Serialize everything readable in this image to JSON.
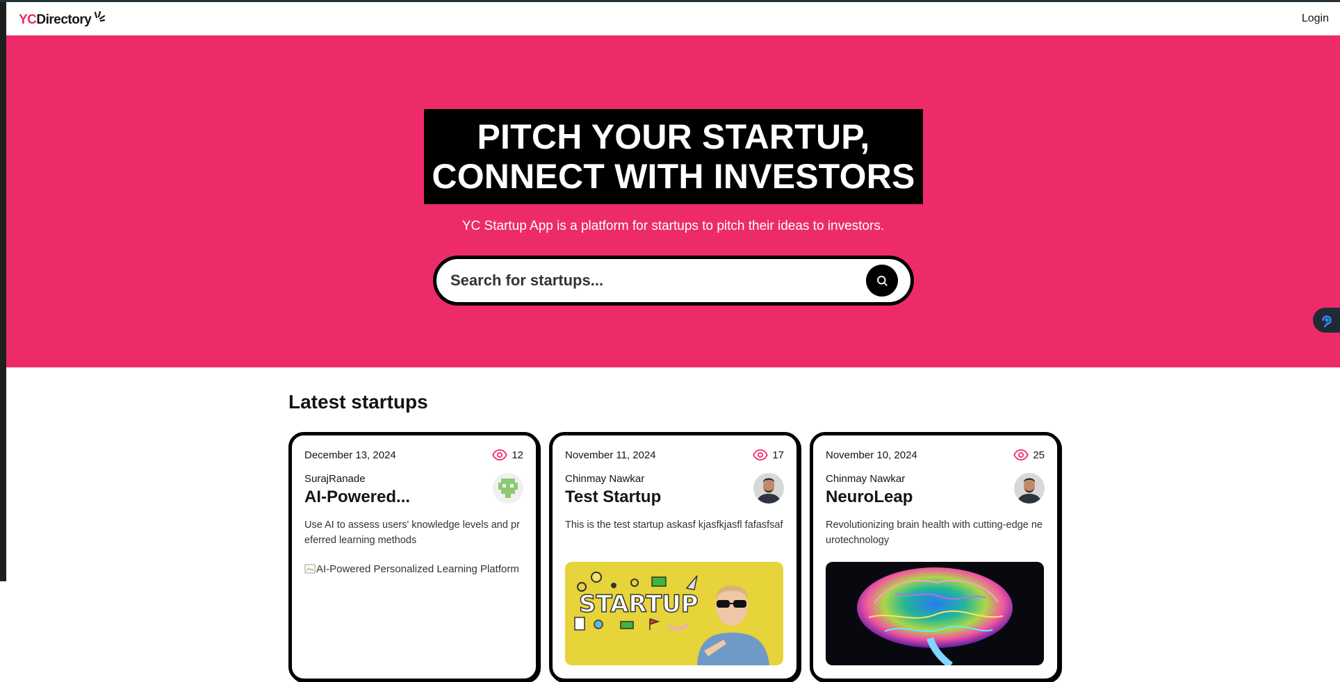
{
  "nav": {
    "logo_yc": "YC",
    "logo_directory": "Directory",
    "login_label": "Login"
  },
  "hero": {
    "title_line1": "Pitch Your Startup,",
    "title_line2": "Connect With Investors",
    "subtitle": "YC Startup App is a platform for startups to pitch their ideas to investors.",
    "search_placeholder": "Search for startups..."
  },
  "colors": {
    "brand_pink": "#ee2b69",
    "black": "#000000"
  },
  "latest": {
    "title": "Latest startups",
    "cards": [
      {
        "date": "December 13, 2024",
        "views": "12",
        "author": "SurajRanade",
        "title": "AI-Powered...",
        "description": "Use AI to assess users' knowledge levels and preferred learning methods",
        "image_alt": "AI-Powered Personalized Learning Platform",
        "avatar_icon": "pixel-avatar-icon"
      },
      {
        "date": "November 11, 2024",
        "views": "17",
        "author": "Chinmay Nawkar",
        "title": "Test Startup",
        "description": "This is the test startup askasf kjasfkjasfl fafasfsaf",
        "image_text": "STARTUP",
        "avatar_icon": "user-photo-icon"
      },
      {
        "date": "November 10, 2024",
        "views": "25",
        "author": "Chinmay Nawkar",
        "title": "NeuroLeap",
        "description": "Revolutionizing brain health with cutting-edge neurotechnology",
        "avatar_icon": "user-photo-icon"
      }
    ]
  }
}
